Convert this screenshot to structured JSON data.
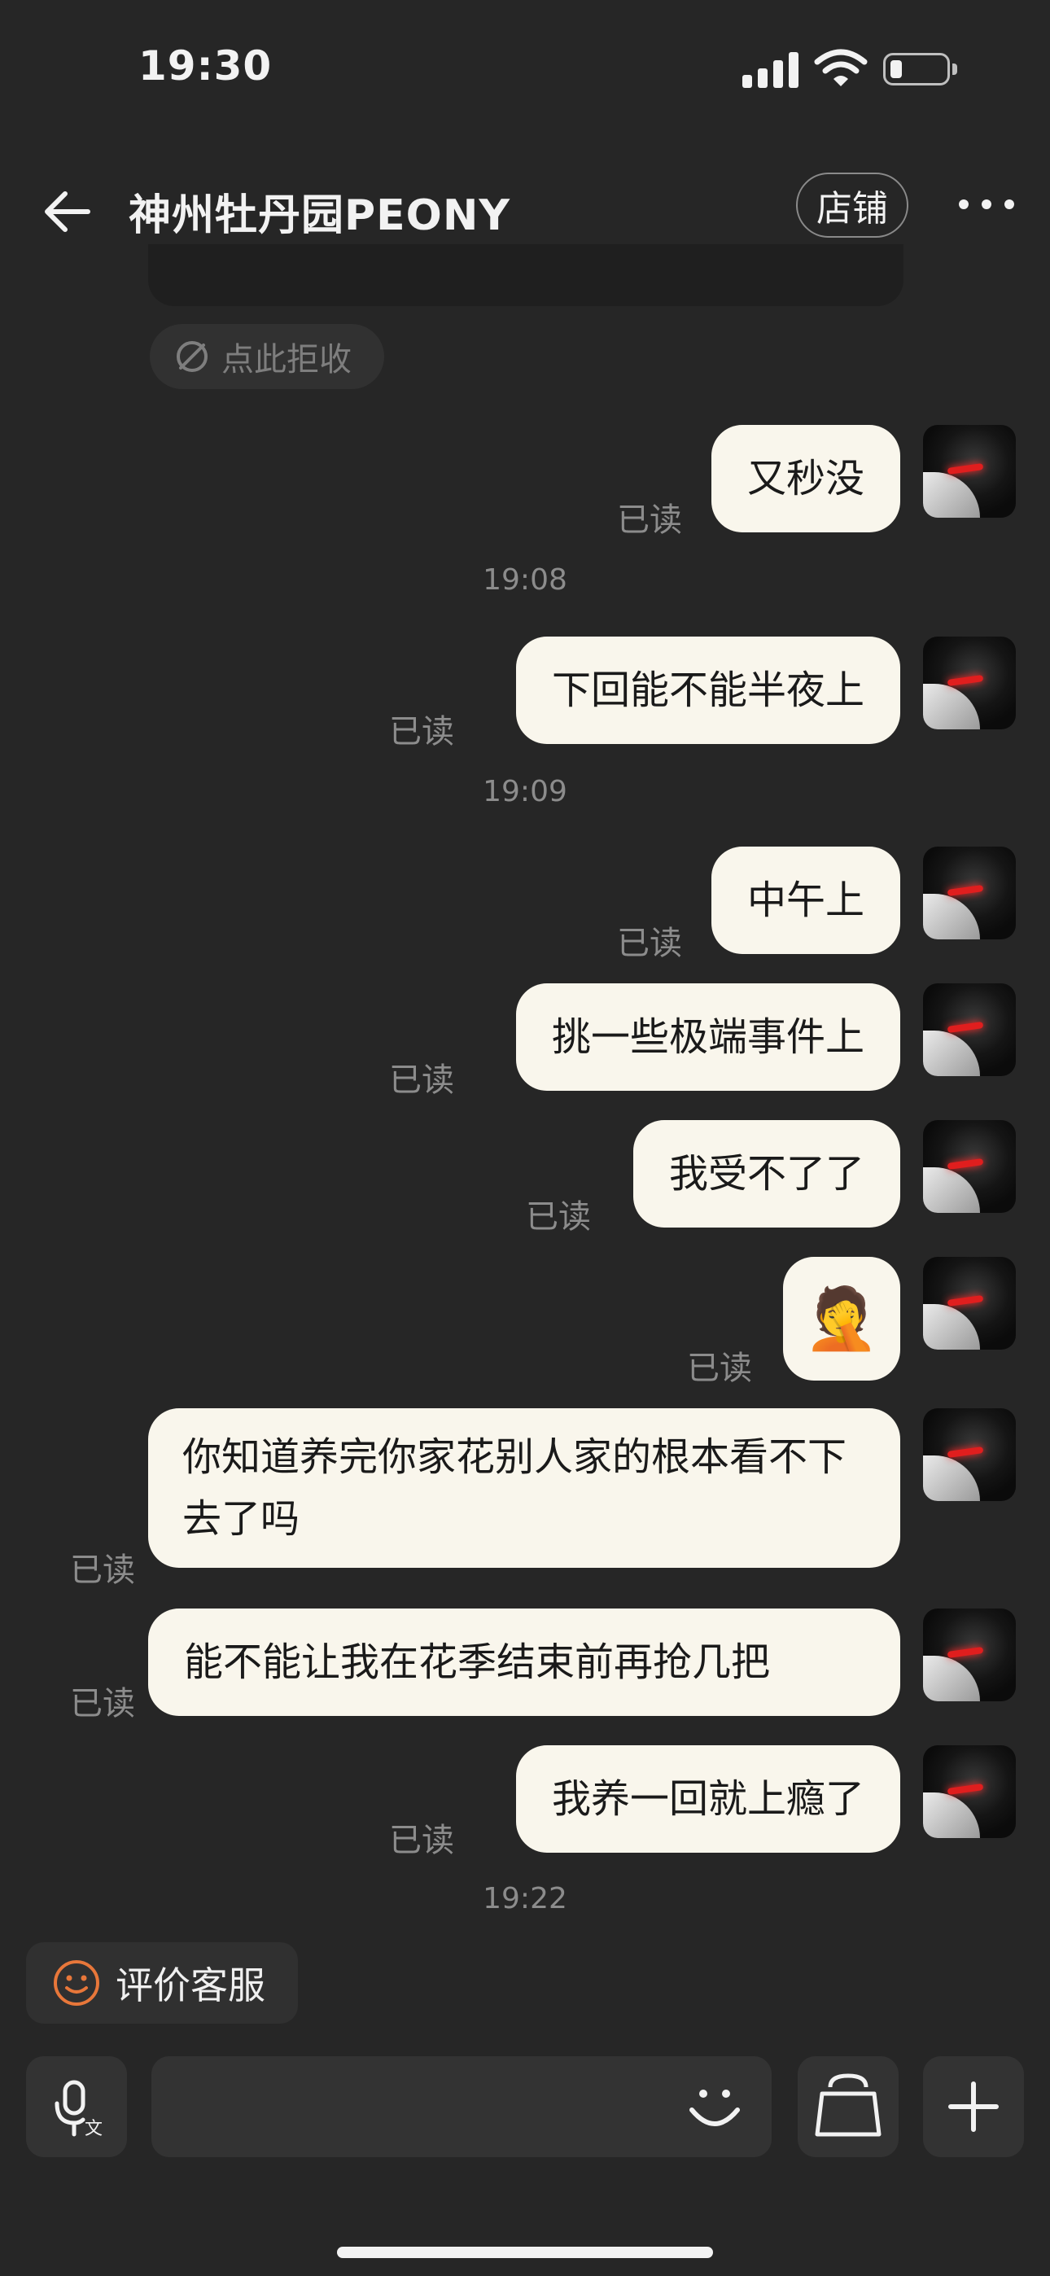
{
  "status_bar": {
    "time": "19:30"
  },
  "header": {
    "title": "神州牡丹园PEONY",
    "store_label": "店铺"
  },
  "reject_pill": {
    "label": "点此拒收"
  },
  "messages": [
    {
      "text": "又秒没",
      "read": "已读"
    },
    {
      "text": "下回能不能半夜上",
      "read": "已读"
    },
    {
      "text": "中午上",
      "read": "已读"
    },
    {
      "text": "挑一些极端事件上",
      "read": "已读"
    },
    {
      "text": "我受不了了",
      "read": "已读"
    },
    {
      "emoji": "🤦",
      "read": "已读"
    },
    {
      "text": "你知道养完你家花别人家的根本看不下去了吗",
      "read": "已读"
    },
    {
      "text": "能不能让我在花季结束前再抢几把",
      "read": "已读"
    },
    {
      "text": "我养一回就上瘾了",
      "read": "已读"
    }
  ],
  "timestamps": [
    "19:08",
    "19:09",
    "19:22"
  ],
  "rate_pill": {
    "label": "评价客服"
  },
  "icons": {
    "back": "arrow-left-icon",
    "more": "more-dots-icon",
    "reject": "eye-off-icon",
    "rate": "smile-icon",
    "voice": "mic-translate-icon",
    "emoji": "emoji-icon",
    "shop": "shopping-bag-icon",
    "add": "plus-icon"
  }
}
